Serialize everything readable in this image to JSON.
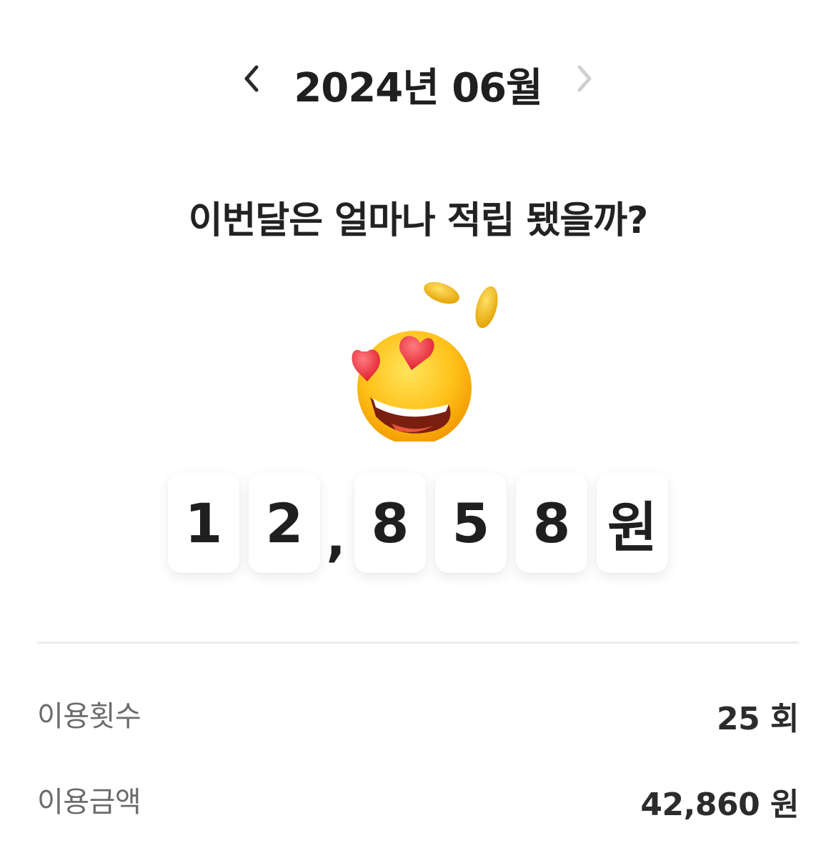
{
  "header": {
    "month_title": "2024년 06월",
    "prev_icon": "chevron-left-icon",
    "next_icon": "chevron-right-icon"
  },
  "question": "이번달은 얼마나 적립 됐을까?",
  "emoji": "heart-eyes-coins-icon",
  "amount": {
    "chars": [
      "1",
      "2",
      ",",
      "8",
      "5",
      "8",
      "원"
    ]
  },
  "stats": {
    "count_label": "이용횟수",
    "count_value": "25 회",
    "amount_label": "이용금액",
    "amount_value": "42,860 원"
  },
  "colors": {
    "text": "#1f1f1f",
    "label": "#6b6b6b",
    "next_disabled": "#d0d0d0",
    "divider": "#ebebeb"
  }
}
